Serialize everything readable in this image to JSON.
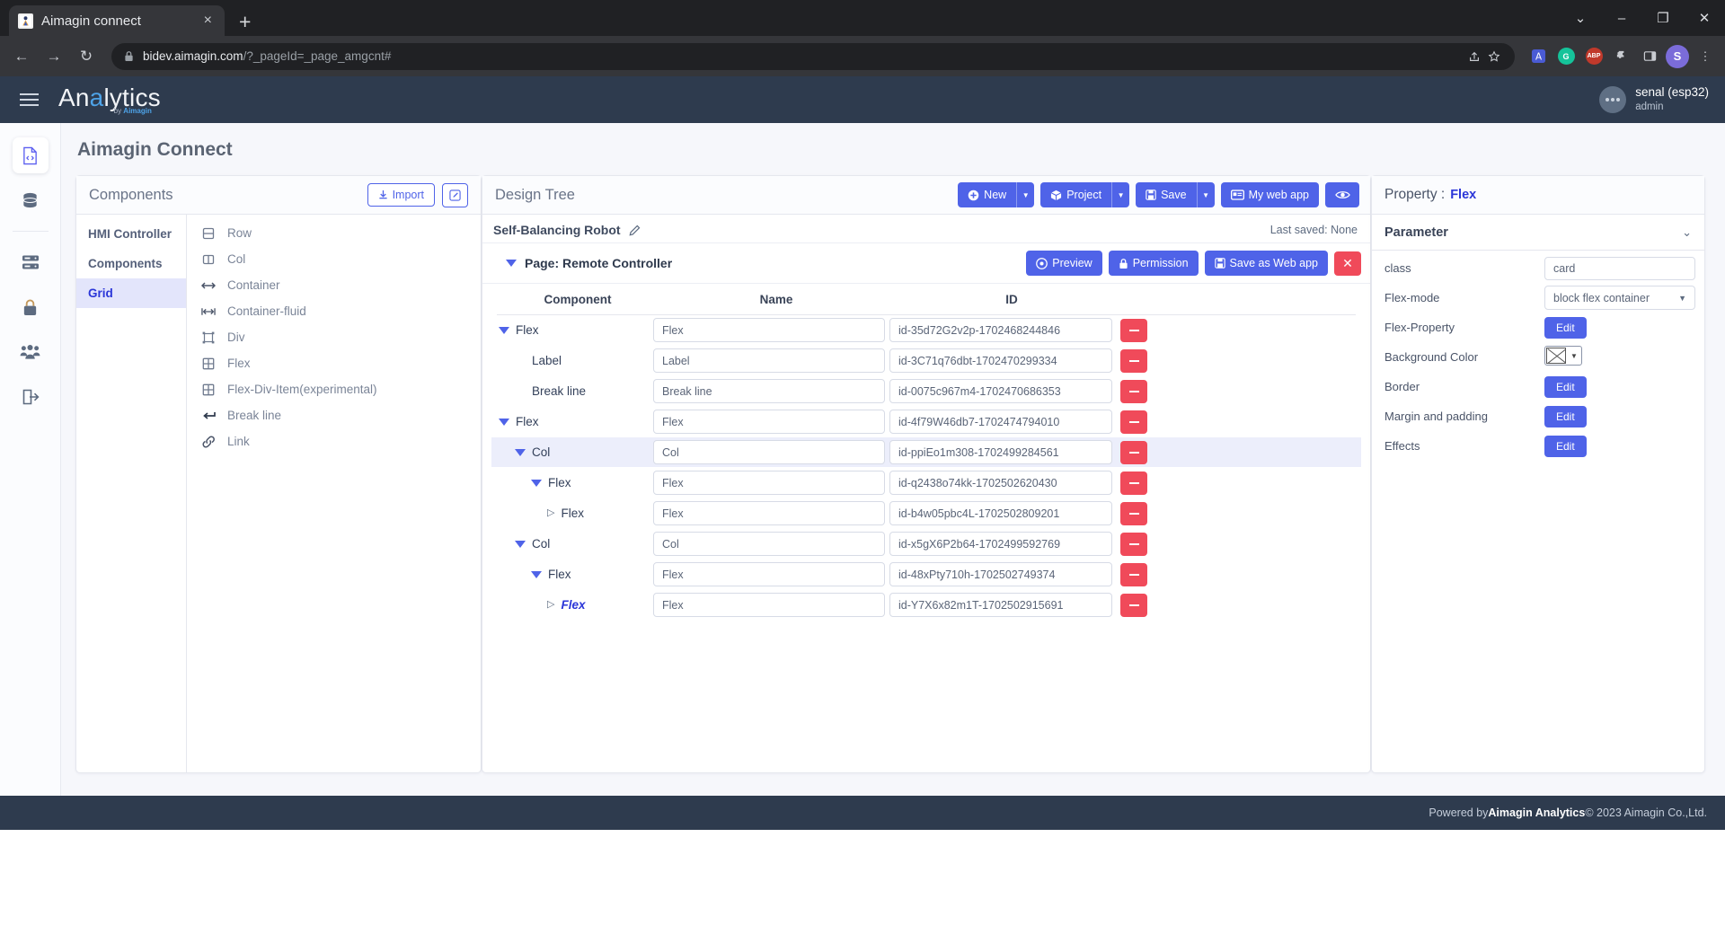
{
  "browser": {
    "tab": {
      "title": "Aimagin connect",
      "favicon_name": "aimagin-favicon",
      "close_label": "×"
    },
    "new_tab_label": "+",
    "window_controls": {
      "minimize": "–",
      "maximize": "❐",
      "close": "✕",
      "chevron": "⌄"
    },
    "nav": {
      "back": "←",
      "forward": "→",
      "reload": "↻"
    },
    "omnibox": {
      "lock_icon": "lock-icon",
      "url_host": "bidev.aimagin.com",
      "url_path": "/?_pageId=_page_amgcnt#",
      "share_icon": "share-icon",
      "bookmark_icon": "star-icon"
    },
    "extensions": [
      {
        "name": "translate-icon",
        "glyph": "文",
        "color": "#5b8def"
      },
      {
        "name": "grammarly-icon",
        "glyph": "G",
        "color": "#15c39a"
      },
      {
        "name": "abp-icon",
        "glyph": "ABP",
        "color": "#c0392b"
      },
      {
        "name": "puzzle-icon",
        "glyph": "❖",
        "color": "#c9ccd1"
      },
      {
        "name": "sidepanel-icon",
        "glyph": "▥",
        "color": "#c9ccd1"
      }
    ],
    "profile_initial": "S",
    "menu_icon": "⋮"
  },
  "header": {
    "menu_icon": "hamburger-icon",
    "brand_pre": "An",
    "brand_hl": "a",
    "brand_post": "lytics",
    "brand_sub_pre": "by ",
    "brand_sub_brand": "Aimagin",
    "user_name": "senal (esp32)",
    "user_role": "admin"
  },
  "rail": [
    {
      "name": "sidebar-item-code",
      "icon": "file-code-icon",
      "active": true
    },
    {
      "name": "sidebar-item-database",
      "icon": "database-icon",
      "active": false
    },
    {
      "name": "sidebar-item-server",
      "icon": "server-icon",
      "active": false
    },
    {
      "name": "sidebar-item-security",
      "icon": "lock-icon",
      "active": false
    },
    {
      "name": "sidebar-item-users",
      "icon": "users-icon",
      "active": false
    },
    {
      "name": "sidebar-item-logout",
      "icon": "logout-icon",
      "active": false
    }
  ],
  "page_title": "Aimagin Connect",
  "components_panel": {
    "title": "Components",
    "import_label": "Import",
    "import_icon": "download-icon",
    "edit_icon": "pencil-square-icon",
    "categories": [
      {
        "label": "HMI Controller",
        "active": false
      },
      {
        "label": "Components",
        "active": false
      },
      {
        "label": "Grid",
        "active": true
      }
    ],
    "items": [
      {
        "label": "Row",
        "icon": "row-icon"
      },
      {
        "label": "Col",
        "icon": "col-icon"
      },
      {
        "label": "Container",
        "icon": "arrows-horizontal-icon"
      },
      {
        "label": "Container-fluid",
        "icon": "arrows-bounded-icon"
      },
      {
        "label": "Div",
        "icon": "div-box-icon"
      },
      {
        "label": "Flex",
        "icon": "grid-icon"
      },
      {
        "label": "Flex-Div-Item(experimental)",
        "icon": "grid-icon"
      },
      {
        "label": "Break line",
        "icon": "enter-arrow-icon"
      },
      {
        "label": "Link",
        "icon": "link-icon"
      }
    ]
  },
  "design_tree": {
    "title": "Design Tree",
    "toolbar": [
      {
        "label": "New",
        "icon": "plus-circle-icon",
        "has_caret": true
      },
      {
        "label": "Project",
        "icon": "box-icon",
        "has_caret": true
      },
      {
        "label": "Save",
        "icon": "save-icon",
        "has_caret": true
      },
      {
        "label": "My web app",
        "icon": "window-icon",
        "has_caret": false
      }
    ],
    "preview_eye_icon": "eye-icon",
    "project_name": "Self-Balancing Robot",
    "project_edit_icon": "pencil-icon",
    "last_saved_label": "Last saved:",
    "last_saved_value": "None",
    "page_label": "Page: Remote Controller",
    "page_buttons": [
      {
        "label": "Preview",
        "icon": "eye-circle-icon"
      },
      {
        "label": "Permission",
        "icon": "lock-icon"
      },
      {
        "label": "Save as Web app",
        "icon": "save-icon"
      }
    ],
    "page_close_label": "✕",
    "columns": {
      "component": "Component",
      "name": "Name",
      "id": "ID"
    },
    "rows": [
      {
        "component": "Flex",
        "indent": 0,
        "toggle": "down",
        "name": "Flex",
        "id": "id-35d72G2v2p-1702468244846",
        "highlight": false,
        "emphasis": false
      },
      {
        "component": "Label",
        "indent": 1,
        "toggle": "none",
        "name": "Label",
        "id": "id-3C71q76dbt-1702470299334",
        "highlight": false,
        "emphasis": false
      },
      {
        "component": "Break line",
        "indent": 1,
        "toggle": "none",
        "name": "Break line",
        "id": "id-0075c967m4-1702470686353",
        "highlight": false,
        "emphasis": false
      },
      {
        "component": "Flex",
        "indent": 0,
        "toggle": "down",
        "name": "Flex",
        "id": "id-4f79W46db7-1702474794010",
        "highlight": false,
        "emphasis": false
      },
      {
        "component": "Col",
        "indent": 1,
        "toggle": "down",
        "name": "Col",
        "id": "id-ppiEo1m308-1702499284561",
        "highlight": true,
        "emphasis": false
      },
      {
        "component": "Flex",
        "indent": 2,
        "toggle": "down",
        "name": "Flex",
        "id": "id-q2438o74kk-1702502620430",
        "highlight": false,
        "emphasis": false
      },
      {
        "component": "Flex",
        "indent": 3,
        "toggle": "right",
        "name": "Flex",
        "id": "id-b4w05pbc4L-1702502809201",
        "highlight": false,
        "emphasis": false
      },
      {
        "component": "Col",
        "indent": 1,
        "toggle": "down",
        "name": "Col",
        "id": "id-x5gX6P2b64-1702499592769",
        "highlight": false,
        "emphasis": false
      },
      {
        "component": "Flex",
        "indent": 2,
        "toggle": "down",
        "name": "Flex",
        "id": "id-48xPty710h-1702502749374",
        "highlight": false,
        "emphasis": false
      },
      {
        "component": "Flex",
        "indent": 3,
        "toggle": "right",
        "name": "Flex",
        "id": "id-Y7X6x82m1T-1702502915691",
        "highlight": false,
        "emphasis": true
      }
    ],
    "row_delete_label": "−"
  },
  "property_panel": {
    "head_label": "Property :",
    "head_value": "Flex",
    "param_title": "Parameter",
    "param_chevron": "⌄",
    "rows": [
      {
        "label": "class",
        "type": "input",
        "value": "card"
      },
      {
        "label": "Flex-mode",
        "type": "select",
        "value": "block flex container"
      },
      {
        "label": "Flex-Property",
        "type": "button",
        "value": "Edit"
      },
      {
        "label": "Background Color",
        "type": "color",
        "value": ""
      },
      {
        "label": "Border",
        "type": "button",
        "value": "Edit"
      },
      {
        "label": "Margin and padding",
        "type": "button",
        "value": "Edit"
      },
      {
        "label": "Effects",
        "type": "button",
        "value": "Edit"
      }
    ]
  },
  "footer": {
    "pre": "Powered by ",
    "brand": "Aimagin Analytics",
    "post": " © 2023 Aimagin Co.,Ltd."
  },
  "colors": {
    "primary": "#4f63e8",
    "danger": "#f04a5a",
    "header_bg": "#2e3b4e",
    "accent_text": "#2b36d8"
  }
}
